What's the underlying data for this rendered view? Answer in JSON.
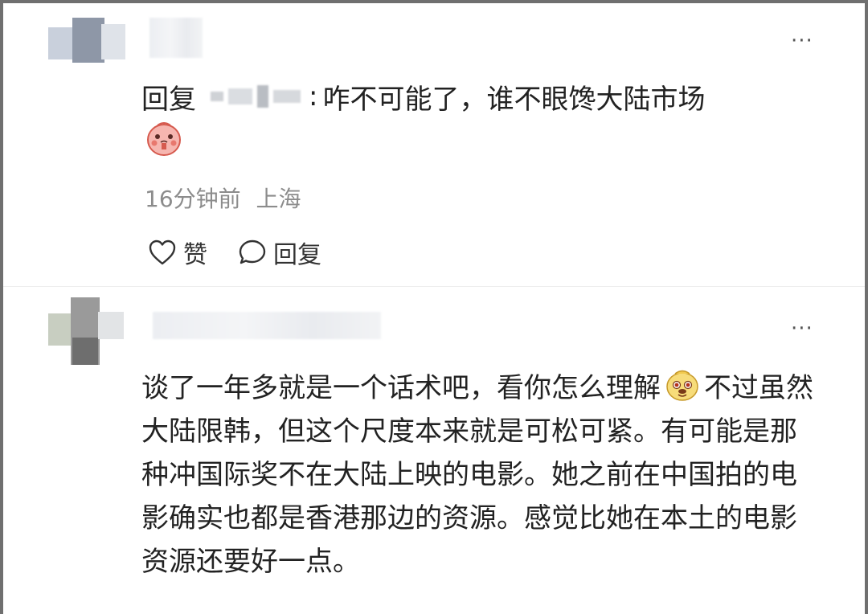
{
  "comment1": {
    "reply_prefix": "回复",
    "reply_separator": ":",
    "reply_text": "咋不可能了，谁不眼馋大陆市场",
    "emoji": "face-emoji",
    "time": "16分钟前",
    "location": "上海",
    "like_label": "赞",
    "reply_label": "回复",
    "more_label": "···"
  },
  "comment2": {
    "more_label": "···",
    "text_part1": "谈了一年多就是一个话术吧，看你怎么理解",
    "emoji": "dog-face-emoji",
    "text_part2": "不过虽然大陆限韩，但这个尺度本来就是可松可紧。有可能是那种冲国际奖不在大陆上映的电影。她之前在中国拍的电影确实也都是香港那边的资源。感觉比她在本土的电影资源还要好一点。"
  },
  "colors": {
    "text": "#222222",
    "meta": "#8c8c8c",
    "background": "#ffffff"
  }
}
